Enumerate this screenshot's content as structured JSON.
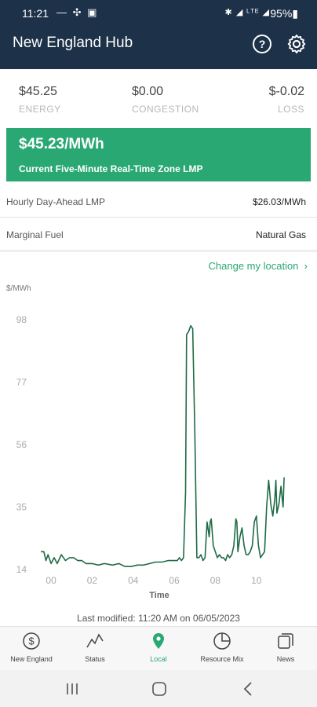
{
  "status_bar": {
    "time": "11:21",
    "left_icons": "— ✣ ▣",
    "right_icons": "✱ ◢ ᴸᵀᴱ ◢",
    "battery": "95%▮"
  },
  "app_bar": {
    "title": "New England Hub",
    "help_label": "?"
  },
  "metrics": {
    "energy": {
      "value": "$45.25",
      "label": "ENERGY"
    },
    "congestion": {
      "value": "$0.00",
      "label": "CONGESTION"
    },
    "loss": {
      "value": "$-0.02",
      "label": "LOSS"
    }
  },
  "lmp_card": {
    "value": "$45.23/MWh",
    "subtitle": "Current Five-Minute Real-Time Zone LMP",
    "color": "#2aa874"
  },
  "rows": {
    "day_ahead": {
      "label": "Hourly Day-Ahead LMP",
      "value": "$26.03/MWh"
    },
    "fuel": {
      "label": "Marginal Fuel",
      "value": "Natural Gas"
    }
  },
  "change_location": "Change my location",
  "chart_data": {
    "type": "line",
    "ylabel": "$/MWh",
    "xlabel": "Time",
    "yticks": [
      "98",
      "77",
      "56",
      "35",
      "14"
    ],
    "xticks": [
      "00",
      "02",
      "04",
      "06",
      "08",
      "10"
    ],
    "ylim": [
      14,
      98
    ],
    "xlim": [
      -0.5,
      11.5
    ],
    "grid": false,
    "line_color": "#1f6b45",
    "series": [
      {
        "x": [
          -0.5,
          -0.35,
          -0.25,
          -0.15,
          0.0,
          0.15,
          0.3,
          0.5,
          0.7,
          0.9,
          1.1,
          1.3,
          1.5,
          1.7,
          2.0,
          2.3,
          2.6,
          3.0,
          3.3,
          3.6,
          3.9,
          4.2,
          4.5,
          4.8,
          5.1,
          5.4,
          5.7,
          6.0,
          6.15,
          6.25,
          6.35,
          6.45,
          6.55,
          6.6,
          6.7,
          6.8,
          6.9,
          7.0,
          7.1,
          7.2,
          7.3,
          7.4,
          7.5,
          7.6,
          7.7,
          7.75,
          7.8,
          7.9,
          8.0,
          8.1,
          8.2,
          8.3,
          8.4,
          8.5,
          8.6,
          8.7,
          8.8,
          8.9,
          9.0,
          9.05,
          9.1,
          9.2,
          9.3,
          9.4,
          9.5,
          9.6,
          9.7,
          9.8,
          9.9,
          10.0,
          10.1,
          10.2,
          10.3,
          10.4,
          10.5,
          10.6,
          10.7,
          10.8,
          10.9,
          10.95,
          11.0,
          11.1,
          11.2,
          11.3,
          11.35
        ],
        "y": [
          20,
          20,
          17,
          19,
          16,
          18,
          16,
          19,
          17,
          18,
          18,
          17,
          17,
          16,
          16,
          15.5,
          16,
          15.5,
          16,
          15,
          15,
          15.5,
          15.5,
          16,
          16.5,
          16.5,
          17,
          17,
          17,
          18,
          17,
          18,
          40,
          93,
          94,
          96,
          95,
          60,
          18,
          18,
          19,
          17,
          18,
          30,
          25,
          30,
          31,
          22,
          20,
          18,
          19,
          18,
          18,
          17,
          19,
          18,
          19,
          22,
          31,
          30,
          20,
          25,
          28,
          22,
          19,
          19,
          20,
          22,
          30,
          32,
          22,
          18,
          19,
          20,
          35,
          44,
          36,
          32,
          38,
          44,
          33,
          36,
          42,
          35,
          45
        ]
      }
    ]
  },
  "last_modified": "Last modified: 11:20 AM on 06/05/2023",
  "bottom_nav": [
    {
      "label": "New England",
      "icon": "dollar-circle-icon"
    },
    {
      "label": "Status",
      "icon": "trend-line-icon"
    },
    {
      "label": "Local",
      "icon": "location-pin-icon",
      "active": true
    },
    {
      "label": "Resource Mix",
      "icon": "pie-chart-icon"
    },
    {
      "label": "News",
      "icon": "newspaper-icon"
    }
  ],
  "colors": {
    "header": "#1d3148",
    "accent": "#2aa874"
  }
}
